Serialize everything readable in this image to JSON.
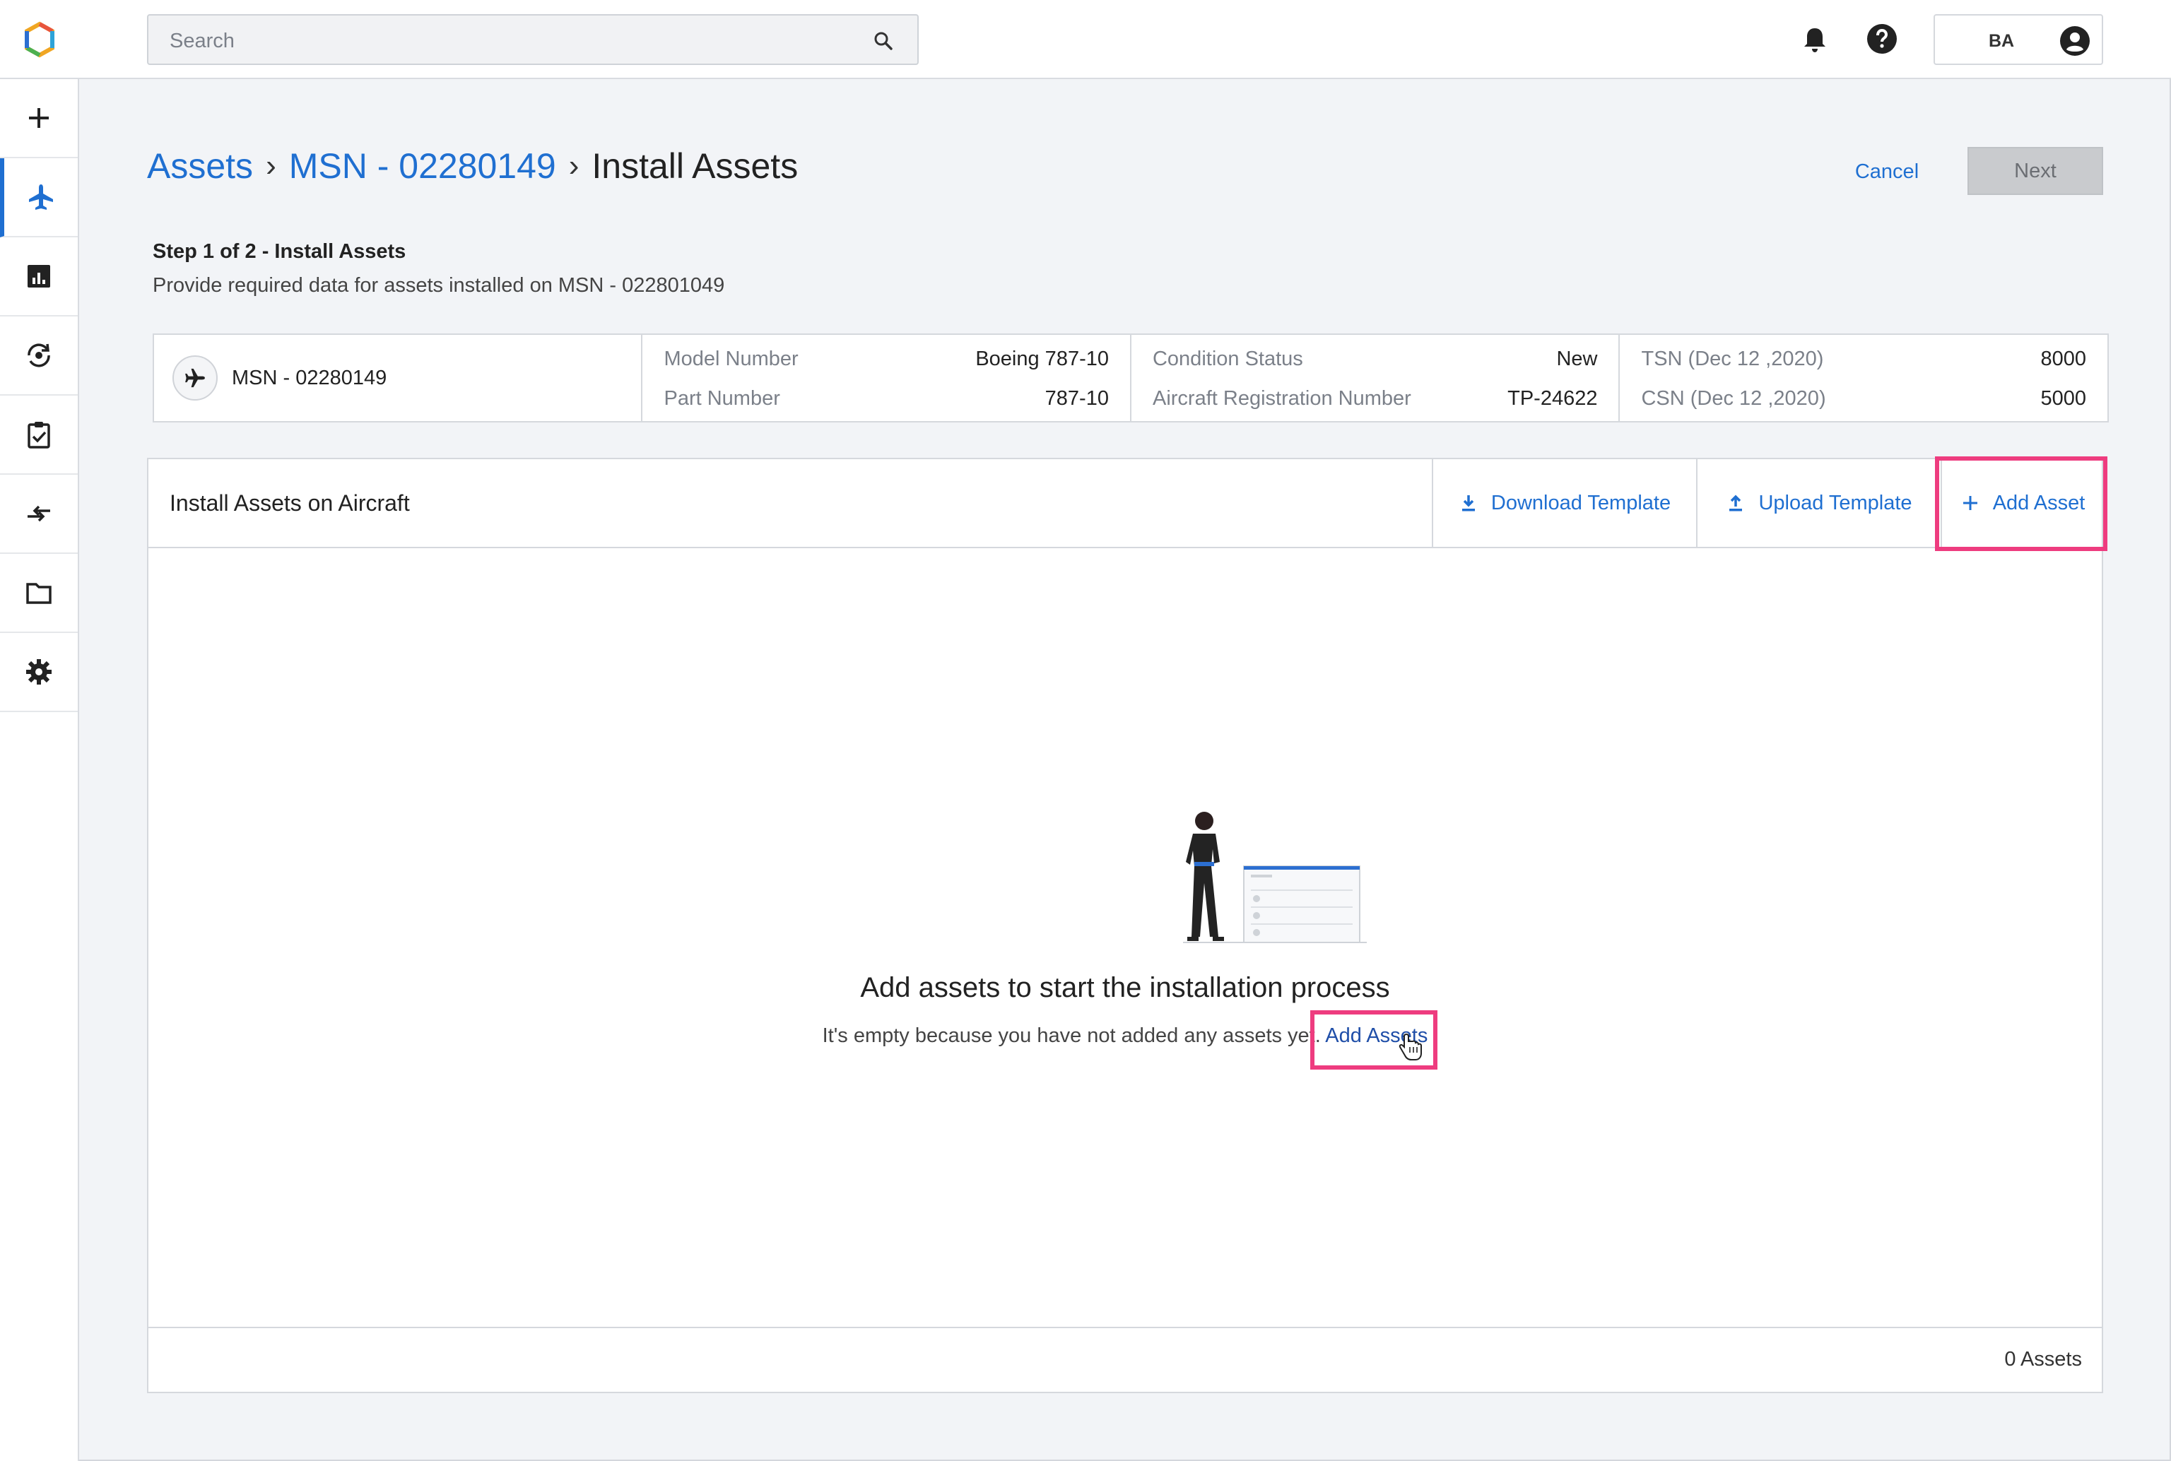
{
  "search": {
    "placeholder": "Search"
  },
  "user": {
    "initials": "BA"
  },
  "sidebar": {
    "items": [
      {
        "icon": "plus-icon"
      },
      {
        "icon": "airplane-icon",
        "active": true
      },
      {
        "icon": "bar-chart-icon"
      },
      {
        "icon": "sync-settings-icon"
      },
      {
        "icon": "clipboard-check-icon"
      },
      {
        "icon": "swap-arrows-icon"
      },
      {
        "icon": "folder-icon"
      },
      {
        "icon": "gear-icon"
      }
    ]
  },
  "breadcrumb": {
    "items": [
      "Assets",
      "MSN - 02280149"
    ],
    "separator": "›",
    "current": "Install Assets"
  },
  "actions": {
    "cancel": "Cancel",
    "next": "Next"
  },
  "step": {
    "title": "Step 1 of 2 - Install Assets",
    "description": "Provide required data for assets installed on MSN - 022801049"
  },
  "aircraft": {
    "msn": "MSN - 02280149",
    "model_number_label": "Model Number",
    "model_number": "Boeing 787-10",
    "part_number_label": "Part Number",
    "part_number": "787-10",
    "condition_label": "Condition Status",
    "condition": "New",
    "registration_label": "Aircraft Registration Number",
    "registration": "TP-24622",
    "tsn_label": "TSN (Dec 12 ,2020)",
    "tsn": "8000",
    "csn_label": "CSN (Dec 12 ,2020)",
    "csn": "5000"
  },
  "install": {
    "title": "Install Assets on Aircraft",
    "download_template": "Download Template",
    "upload_template": "Upload Template",
    "add_asset": "Add Asset",
    "empty_title": "Add assets to start the installation process",
    "empty_desc": "It's empty because you have not added any assets yet.",
    "empty_link": "Add Assets",
    "count": "0 Assets"
  },
  "colors": {
    "accent": "#1f6fd1",
    "highlight": "#ee3c7f",
    "disabled": "#c9cbce"
  }
}
